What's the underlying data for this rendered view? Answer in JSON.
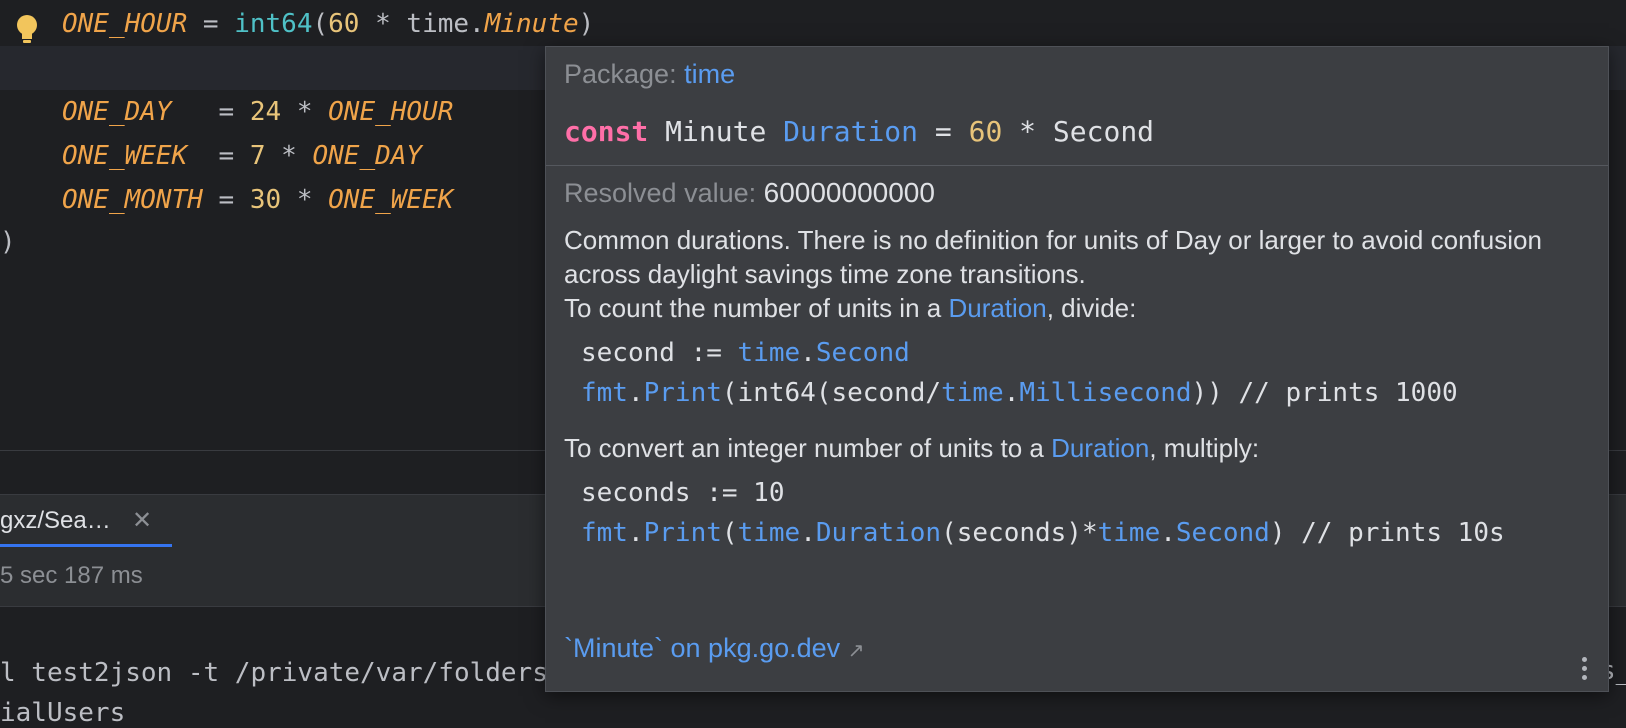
{
  "editor": {
    "line1": {
      "name": "ONE_HOUR",
      "eq": " = ",
      "fn": "int64",
      "open": "(",
      "num": "60",
      "mul": " * ",
      "pkg": "time",
      "dot": ".",
      "member": "Minute",
      "close": ")"
    },
    "line2": {
      "name": "ONE_DAY",
      "eq": "   = ",
      "num": "24",
      "mul": " * ",
      "ref": "ONE_HOUR"
    },
    "line3": {
      "name": "ONE_WEEK",
      "eq": "  = ",
      "num": "7",
      "mul": " * ",
      "ref": "ONE_DAY"
    },
    "line4": {
      "name": "ONE_MONTH",
      "eq": " = ",
      "num": "30",
      "mul": " * ",
      "ref": "ONE_WEEK"
    },
    "closing_paren": ")"
  },
  "tool_window": {
    "tab_label": "gxz/Sea…",
    "status_text": "5 sec 187 ms",
    "console_line1": "l test2json -t /private/var/folders",
    "console_line2": "ialUsers",
    "right_edge_text": "s_"
  },
  "popup": {
    "package_label": "Package:",
    "package_name": "time",
    "signature": {
      "keyword": "const",
      "name": " Minute ",
      "type": "Duration",
      "eq": " = ",
      "value": "60",
      "op": " * ",
      "ref": "Second"
    },
    "resolved_label": "Resolved value:",
    "resolved_value": "60000000000",
    "para1": "Common durations. There is no definition for units of Day or larger to avoid confusion across daylight savings time zone transitions.",
    "para2_prefix": "To count the number of units in a ",
    "para2_link": "Duration",
    "para2_suffix": ", divide:",
    "code1_line1": {
      "a": "second := ",
      "pkg": "time",
      "dot": ".",
      "member": "Second"
    },
    "code1_line2": {
      "pkg": "fmt",
      "dot": ".",
      "fn": "Print",
      "a": "(int64(second/",
      "pkg2": "time",
      "dot2": ".",
      "member": "Millisecond",
      "b": ")) // prints 1000"
    },
    "para3_prefix": "To convert an integer number of units to a ",
    "para3_link": "Duration",
    "para3_suffix": ", multiply:",
    "code2_line1": "seconds := 10",
    "code2_line2": {
      "pkg": "fmt",
      "dot": ".",
      "fn": "Print",
      "open": "(",
      "pkg2": "time",
      "dot2": ".",
      "type": "Duration",
      "a": "(seconds)*",
      "pkg3": "time",
      "dot3": ".",
      "member": "Second",
      "b": ") // prints 10s"
    },
    "external_link": "`Minute` on pkg.go.dev",
    "external_arrow": "↗"
  }
}
